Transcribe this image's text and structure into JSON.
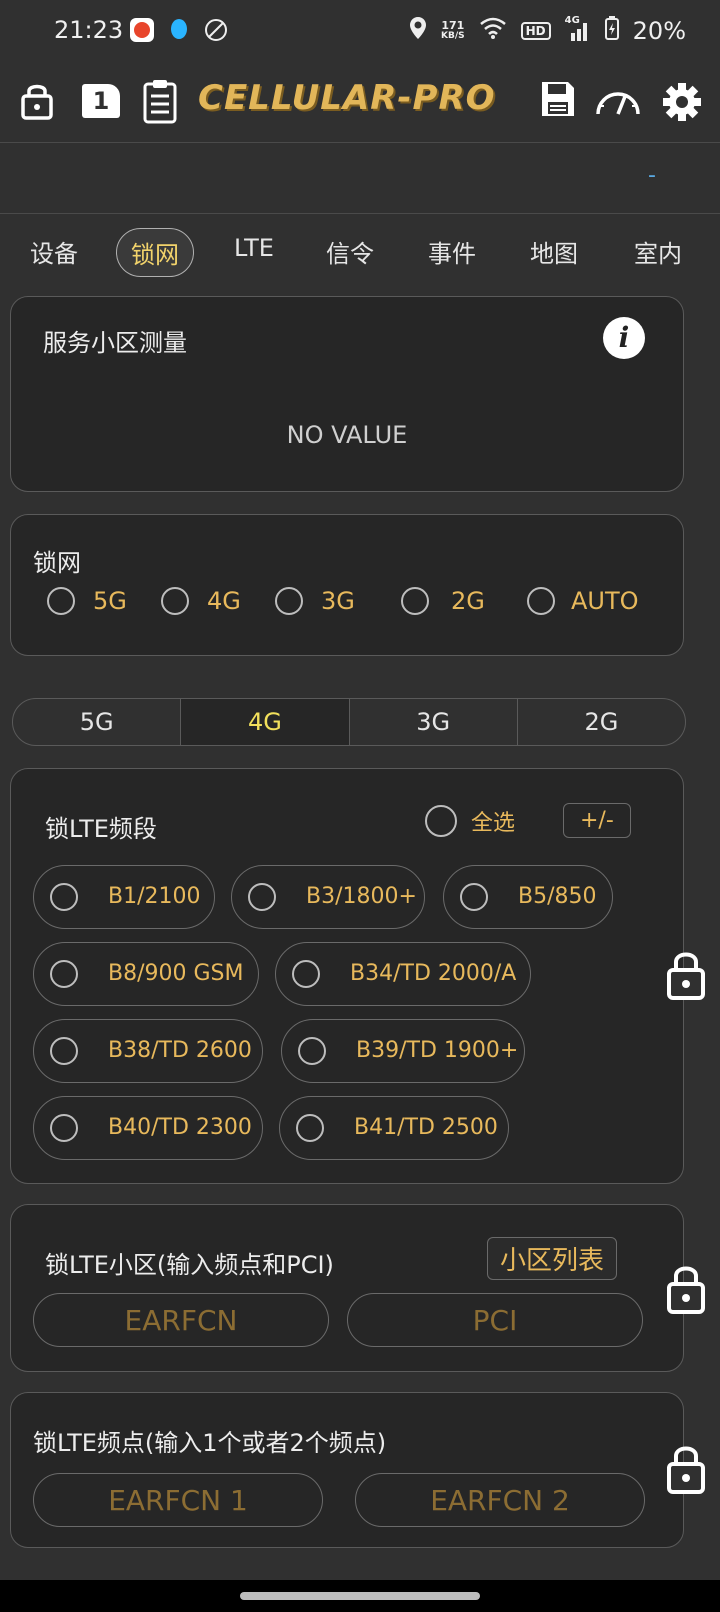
{
  "status": {
    "time": "21:23",
    "net_speed_top": "171",
    "net_speed_unit": "KB/S",
    "hd": "HD",
    "network": "4G",
    "battery": "20%"
  },
  "app": {
    "logo": "CELLULAR-PRO",
    "sim_slot": "1",
    "status_indicator": "-"
  },
  "tabs": [
    {
      "label": "设备",
      "active": false
    },
    {
      "label": "锁网",
      "active": true
    },
    {
      "label": "LTE",
      "active": false
    },
    {
      "label": "信令",
      "active": false
    },
    {
      "label": "事件",
      "active": false
    },
    {
      "label": "地图",
      "active": false
    },
    {
      "label": "室内",
      "active": false
    }
  ],
  "serving_cell": {
    "title": "服务小区测量",
    "value": "NO VALUE"
  },
  "lock_network": {
    "title": "锁网",
    "options": [
      "5G",
      "4G",
      "3G",
      "2G",
      "AUTO"
    ]
  },
  "segments": {
    "items": [
      "5G",
      "4G",
      "3G",
      "2G"
    ],
    "active": "4G"
  },
  "lte_band": {
    "title": "锁LTE频段",
    "select_all": "全选",
    "toggle_label": "+/-",
    "bands": [
      "B1/2100",
      "B3/1800+",
      "B5/850",
      "B8/900 GSM",
      "B34/TD 2000/A",
      "B38/TD 2600",
      "B39/TD 1900+",
      "B40/TD 2300",
      "B41/TD 2500"
    ]
  },
  "lte_cell": {
    "title": "锁LTE小区(输入频点和PCI)",
    "list_button": "小区列表",
    "earfcn_placeholder": "EARFCN",
    "pci_placeholder": "PCI"
  },
  "lte_freq": {
    "title": "锁LTE频点(输入1个或者2个频点)",
    "earfcn1_placeholder": "EARFCN 1",
    "earfcn2_placeholder": "EARFCN 2"
  },
  "colors": {
    "accent": "#e8b95c",
    "active_segment": "#f2e05c",
    "background": "#303030",
    "card": "#262626"
  }
}
